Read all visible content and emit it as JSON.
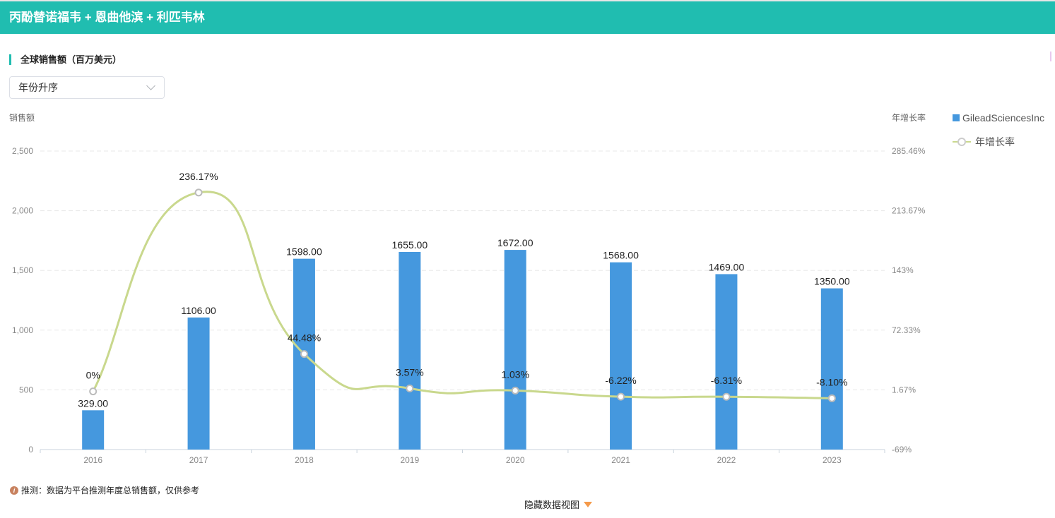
{
  "header": {
    "title": "丙酚替诺福韦 + 恩曲他滨 + 利匹韦林"
  },
  "section": {
    "title": "全球销售额（百万美元）"
  },
  "sort_select": {
    "value": "年份升序"
  },
  "footer": {
    "note": "推测：数据为平台推测年度总销售额，仅供参考",
    "toggle_label": "隐藏数据视图"
  },
  "colors": {
    "bar": "#4598de",
    "line": "#c9d88d",
    "accent": "#20bdb0"
  },
  "chart_data": {
    "type": "bar+line",
    "categories": [
      "2016",
      "2017",
      "2018",
      "2019",
      "2020",
      "2021",
      "2022",
      "2023"
    ],
    "series": [
      {
        "name": "GileadSciencesInc",
        "type": "bar",
        "axis": "left",
        "values": [
          329,
          1106,
          1598,
          1655,
          1672,
          1568,
          1469,
          1350
        ],
        "labels": [
          "329.00",
          "1106.00",
          "1598.00",
          "1655.00",
          "1672.00",
          "1568.00",
          "1469.00",
          "1350.00"
        ]
      },
      {
        "name": "年增长率",
        "type": "line",
        "axis": "right",
        "values": [
          0,
          236.17,
          44.48,
          3.57,
          1.03,
          -6.22,
          -6.31,
          -8.1
        ],
        "labels": [
          "0%",
          "236.17%",
          "44.48%",
          "3.57%",
          "1.03%",
          "-6.22%",
          "-6.31%",
          "-8.10%"
        ]
      }
    ],
    "ylabel": "销售额",
    "y2label": "年增长率",
    "ylim": [
      0,
      2500
    ],
    "yticks": [
      "0",
      "500",
      "1,000",
      "1,500",
      "2,000",
      "2,500"
    ],
    "y2lim": [
      -69,
      285.46
    ],
    "y2ticks": [
      "-69%",
      "1.67%",
      "72.33%",
      "143%",
      "213.67%",
      "285.46%"
    ],
    "grid": true,
    "legend": "top-right"
  }
}
